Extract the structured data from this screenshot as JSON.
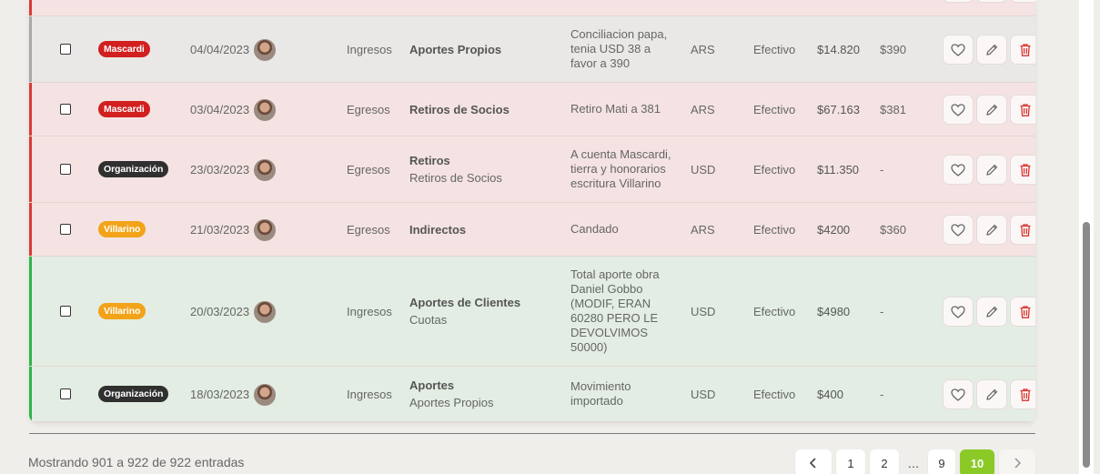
{
  "colors": {
    "red": "#d93a36",
    "gray": "#a9a9a9",
    "green": "#2db34a",
    "accent": "#8bc926"
  },
  "tags": {
    "mascardi": {
      "label": "Mascardi",
      "color": "#d21f1f"
    },
    "organizacion": {
      "label": "Organización",
      "color": "#303030"
    },
    "villarino": {
      "label": "Villarino",
      "color": "#f2a319"
    }
  },
  "rows": [
    {
      "tag_label": "Mascardi",
      "date": "04/04/2023",
      "type": "Ingresos",
      "category": "Aportes Propios",
      "subcategory": "",
      "desc_lines": [
        "Conciliacion papa,",
        "tenia USD 38 a",
        "favor a 390"
      ],
      "currency": "ARS",
      "method": "Efectivo",
      "amount": "$14.820",
      "extra": "$390"
    },
    {
      "tag_label": "Mascardi",
      "date": "03/04/2023",
      "type": "Egresos",
      "category": "Retiros de Socios",
      "subcategory": "",
      "desc_lines": [
        "Retiro Mati a 381"
      ],
      "currency": "ARS",
      "method": "Efectivo",
      "amount": "$67.163",
      "extra": "$381"
    },
    {
      "tag_label": "Organización",
      "date": "23/03/2023",
      "type": "Egresos",
      "category": "Retiros",
      "subcategory": "Retiros de Socios",
      "desc_lines": [
        "A cuenta Mascardi,",
        "tierra y honorarios",
        "escritura Villarino"
      ],
      "currency": "USD",
      "method": "Efectivo",
      "amount": "$11.350",
      "extra": "-"
    },
    {
      "tag_label": "Villarino",
      "date": "21/03/2023",
      "type": "Egresos",
      "category": "Indirectos",
      "subcategory": "",
      "desc_lines": [
        "Candado"
      ],
      "currency": "ARS",
      "method": "Efectivo",
      "amount": "$4200",
      "extra": "$360"
    },
    {
      "tag_label": "Villarino",
      "date": "20/03/2023",
      "type": "Ingresos",
      "category": "Aportes de Clientes",
      "subcategory": "Cuotas",
      "desc_lines": [
        "Total aporte obra",
        "Daniel Gobbo",
        "(MODIF, ERAN",
        "60280 PERO LE",
        "DEVOLVIMOS",
        "50000)"
      ],
      "currency": "USD",
      "method": "Efectivo",
      "amount": "$4980",
      "extra": "-"
    },
    {
      "tag_label": "Organización",
      "date": "18/03/2023",
      "type": "Ingresos",
      "category": "Aportes",
      "subcategory": "Aportes Propios",
      "desc_lines": [
        "Movimiento",
        "importado"
      ],
      "currency": "USD",
      "method": "Efectivo",
      "amount": "$400",
      "extra": "-"
    }
  ],
  "footer": {
    "showing": "Mostrando 901 a 922 de 922 entradas"
  },
  "pagination": {
    "prev": "‹",
    "pages": [
      "1",
      "2",
      "…",
      "9",
      "10"
    ],
    "active": "10",
    "next": "›"
  },
  "icons": {
    "checkbox": "checkbox-icon",
    "favorite": "heart-icon",
    "edit": "pencil-icon",
    "delete": "trash-icon",
    "avatar": "user-avatar"
  }
}
